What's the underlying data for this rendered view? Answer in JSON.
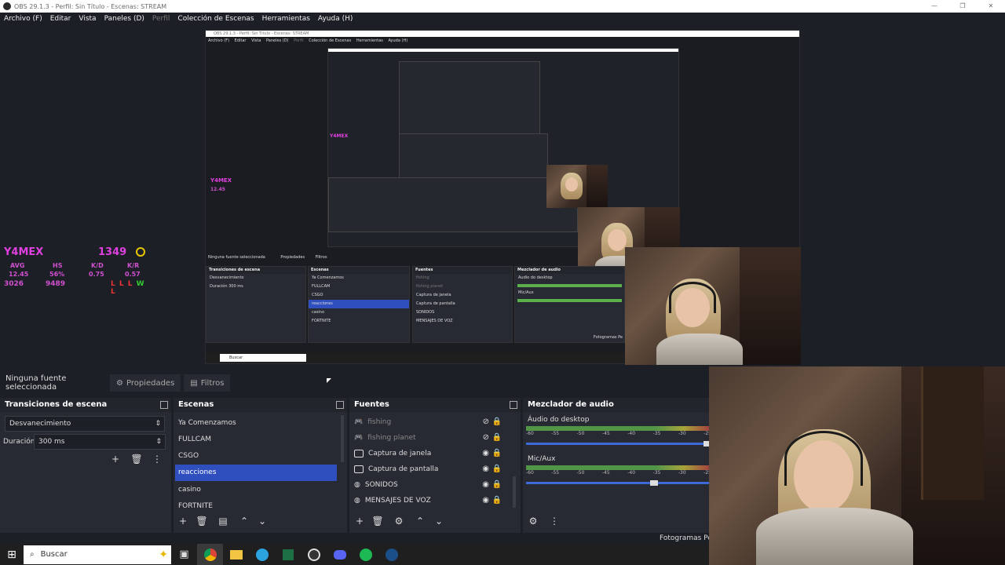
{
  "window": {
    "title": "OBS 29.1.3 - Perfil: Sin Título - Escenas: STREAM",
    "controls": [
      "—",
      "❐",
      "✕"
    ]
  },
  "menu": [
    {
      "label": "Archivo (F)",
      "enabled": true
    },
    {
      "label": "Editar",
      "enabled": true
    },
    {
      "label": "Vista",
      "enabled": true
    },
    {
      "label": "Paneles (D)",
      "enabled": true
    },
    {
      "label": "Perfil",
      "enabled": false
    },
    {
      "label": "Colección de Escenas",
      "enabled": true
    },
    {
      "label": "Herramientas",
      "enabled": true
    },
    {
      "label": "Ayuda (H)",
      "enabled": true
    }
  ],
  "overlay": {
    "name": "Y4MEX",
    "elo": "1349",
    "labels": [
      "AVG",
      "HS",
      "K/D",
      "K/R"
    ],
    "values": [
      "12.45",
      "56%",
      "0.75",
      "0.57"
    ],
    "row3": [
      "3026",
      "9489"
    ],
    "results": "L L L W L"
  },
  "nested": {
    "title": "OBS 29.1.3 - Perfil: Sin Título - Escenas: STREAM",
    "menu": [
      "Archivo (F)",
      "Editar",
      "Vista",
      "Paneles (D)",
      "Perfil",
      "Colección de Escenas",
      "Herramientas",
      "Ayuda (H)"
    ],
    "no_source": "Ninguna fuente seleccionada",
    "props": "Propiedades",
    "filters": "Filtros",
    "transitions_header": "Transiciones de escena",
    "transition": "Desvanecimiento",
    "duration_label": "Duración",
    "duration": "300 ms",
    "scenes_header": "Escenas",
    "scenes": [
      "Ya Comenzamos",
      "FULLCAM",
      "CSGO",
      "reacciones",
      "casino",
      "FORTNITE"
    ],
    "sources_header": "Fuentes",
    "sources": [
      "fishing",
      "fishing planet",
      "Captura de janela",
      "Captura de pantalla",
      "SONIDOS",
      "MENSAJES DE VOZ"
    ],
    "mixer_header": "Mezclador de audio",
    "mixer": [
      "Audio do desktop",
      "Mic/Aux"
    ],
    "search": "Buscar",
    "fps": "Fotogramas Pe"
  },
  "dockbar": {
    "no_source": "Ninguna fuente seleccionada",
    "properties": "Propiedades",
    "filters": "Filtros"
  },
  "transitions": {
    "header": "Transiciones de escena",
    "selected": "Desvanecimiento",
    "duration_label": "Duración",
    "duration": "300 ms"
  },
  "scenes": {
    "header": "Escenas",
    "items": [
      "Ya Comenzamos",
      "FULLCAM",
      "CSGO",
      "reacciones",
      "casino",
      "FORTNITE"
    ],
    "selected_index": 3
  },
  "sources": {
    "header": "Fuentes",
    "items": [
      {
        "label": "fishing",
        "hidden": true
      },
      {
        "label": "fishing planet",
        "hidden": true
      },
      {
        "label": "Captura de janela",
        "hidden": false
      },
      {
        "label": "Captura de pantalla",
        "hidden": false
      },
      {
        "label": "SONIDOS",
        "hidden": false
      },
      {
        "label": "MENSAJES DE VOZ",
        "hidden": false
      }
    ]
  },
  "mixer": {
    "header": "Mezclador de audio",
    "channels": [
      {
        "label": "Áudio do desktop",
        "level": 1.0
      },
      {
        "label": "Mic/Aux",
        "level": 0.7
      }
    ],
    "ticks": [
      "-60",
      "-55",
      "-50",
      "-45",
      "-40",
      "-35",
      "-30",
      "-25"
    ]
  },
  "status": {
    "fps_label": "Fotogramas Per"
  },
  "taskbar": {
    "search_placeholder": "Buscar",
    "icons": [
      "task-view-icon",
      "chrome-icon",
      "file-explorer-icon",
      "telegram-icon",
      "excel-icon",
      "obs-icon",
      "discord-icon",
      "spotify-icon",
      "steam-icon"
    ]
  },
  "colors": {
    "selection": "#2f4fbf",
    "panel": "#272a33",
    "background": "#1d1f26",
    "overlay_magenta": "#e040e0"
  }
}
